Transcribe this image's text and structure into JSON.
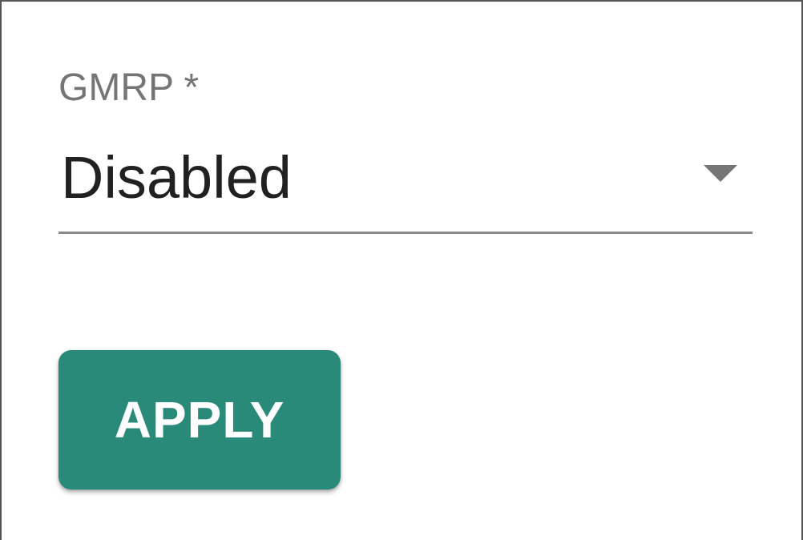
{
  "gmrp_field": {
    "label": "GMRP *",
    "selected_value": "Disabled",
    "arrow_icon": "dropdown-arrow-icon"
  },
  "actions": {
    "apply_label": "APPLY"
  },
  "colors": {
    "accent": "#2a8a7a",
    "label_gray": "#757575",
    "text_dark": "#212121",
    "underline_gray": "#8a8a8a"
  }
}
